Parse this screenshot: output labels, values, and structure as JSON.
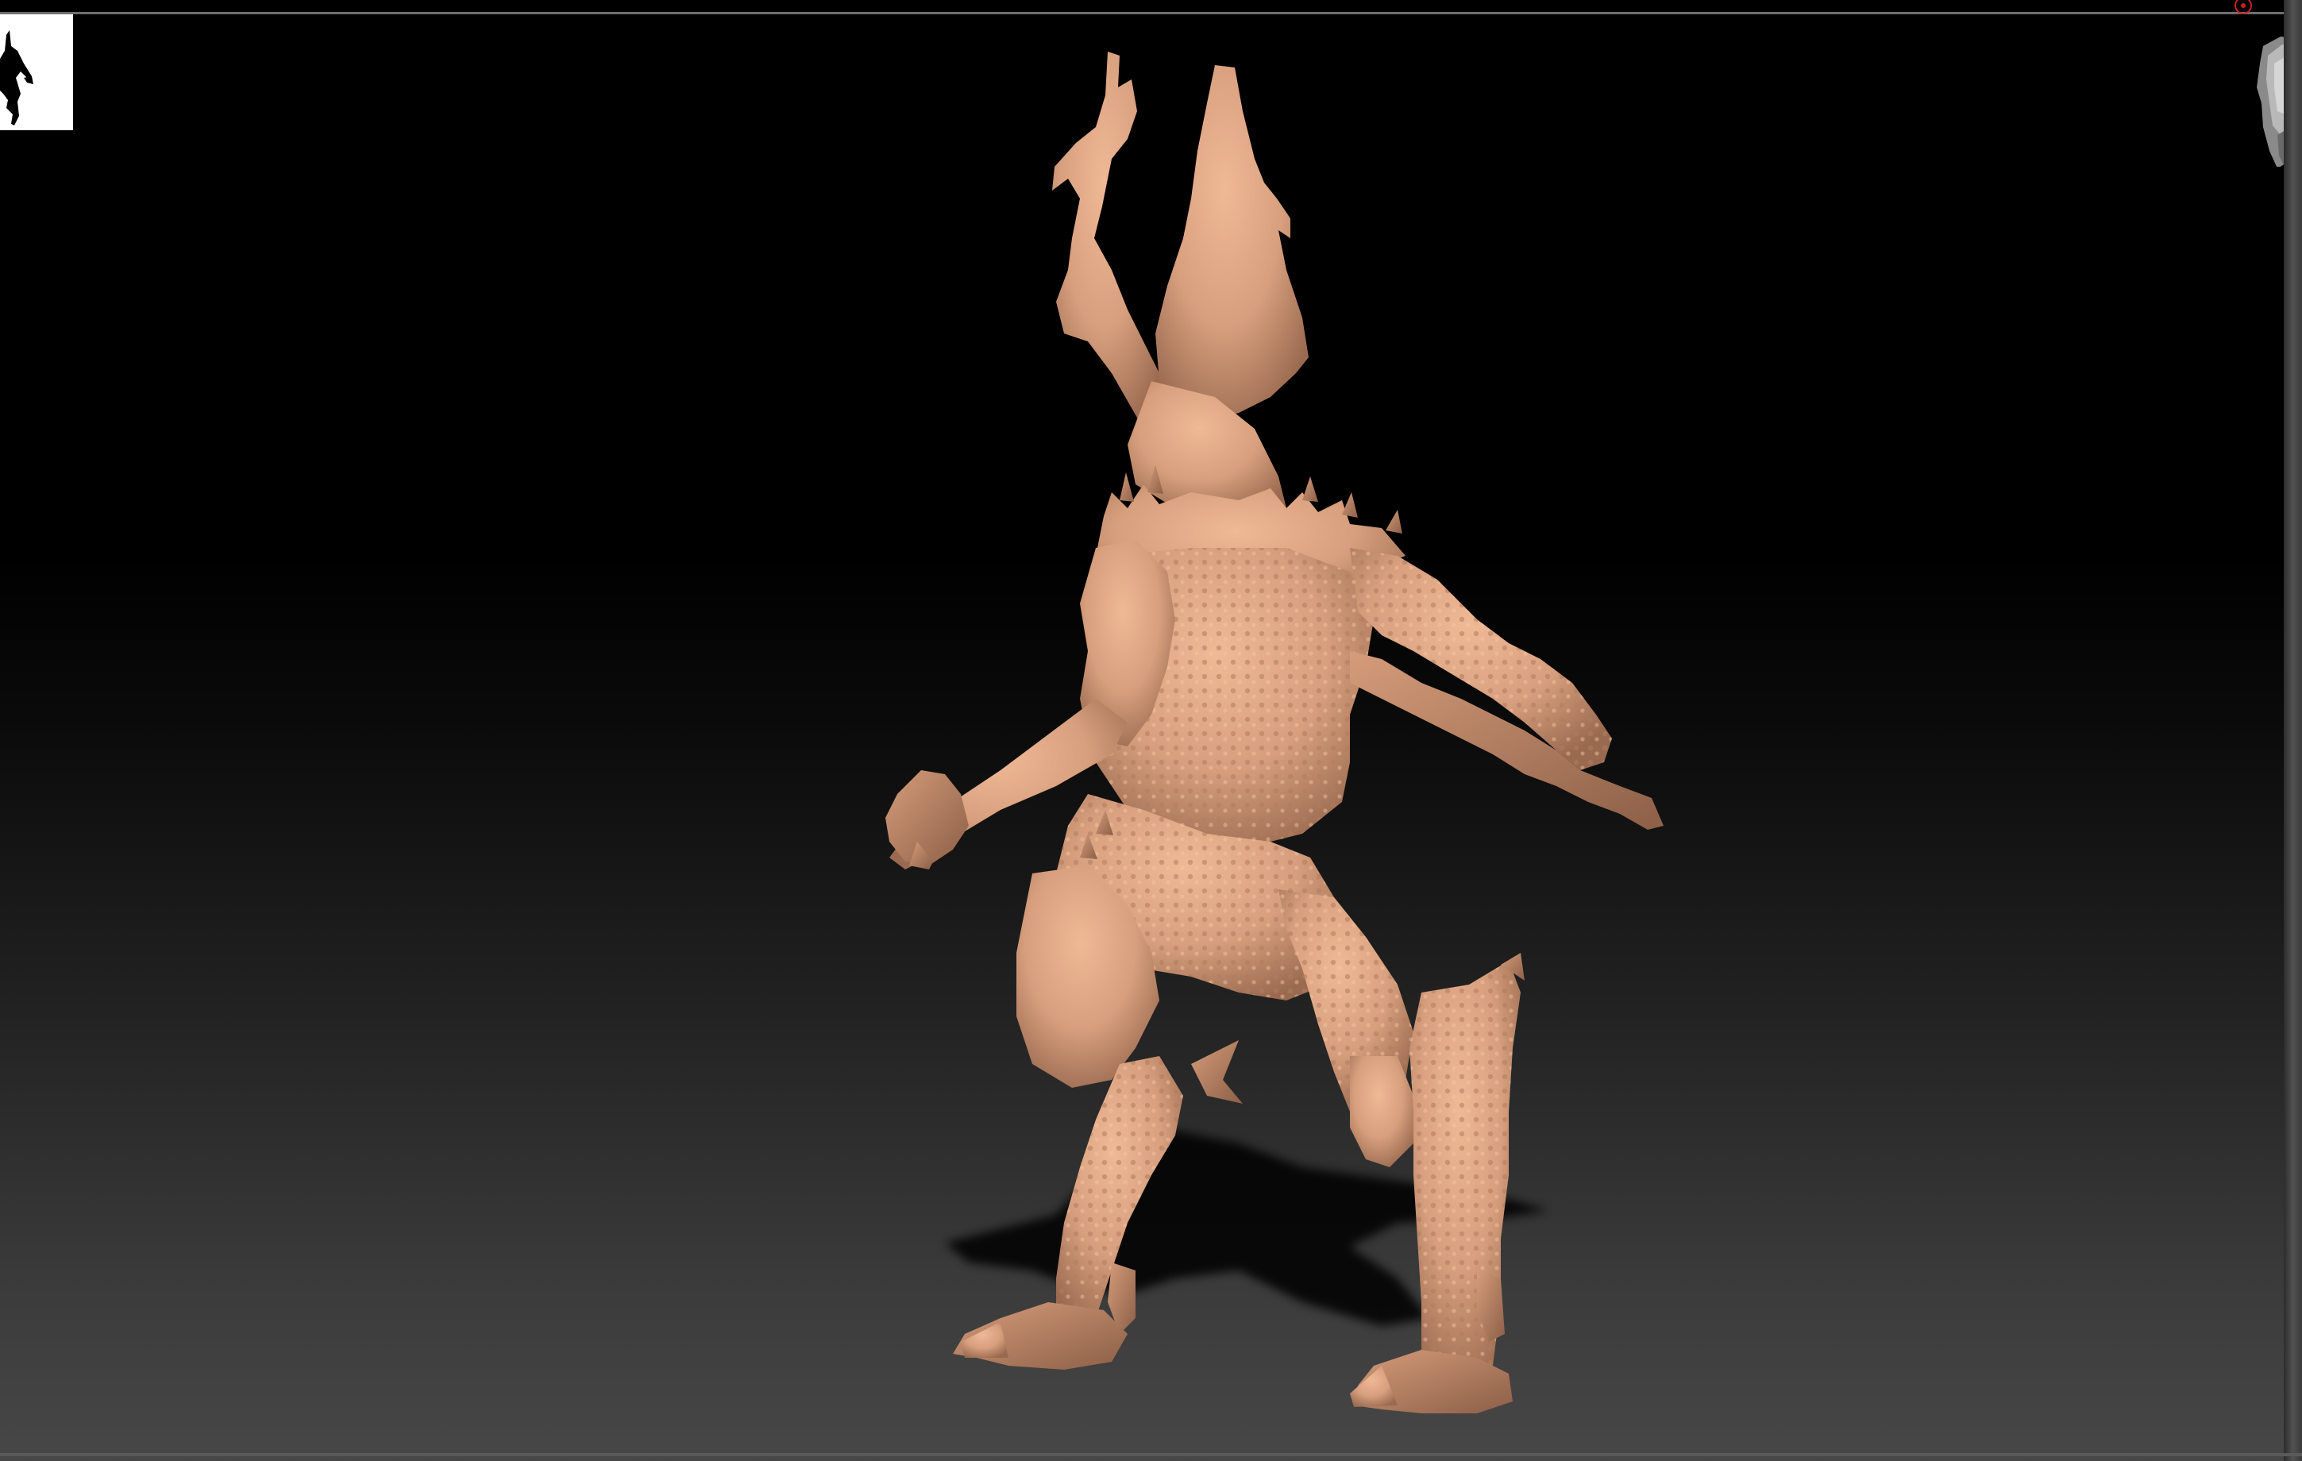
{
  "app": {
    "name": "",
    "accent_color": "#d79f7d",
    "background_color": "#000000",
    "floor_color": "#474747"
  },
  "viewport": {
    "label": "",
    "model_material_color": "#dca281",
    "shadow_color": "#000000"
  },
  "thumbnail": {
    "icon": "model-silhouette-icon",
    "background_color": "#ffffff"
  },
  "navigation": {
    "cube_icon": "head-nav-cube-icon",
    "record_icon": "record-indicator-icon",
    "record_color": "#c82020"
  }
}
